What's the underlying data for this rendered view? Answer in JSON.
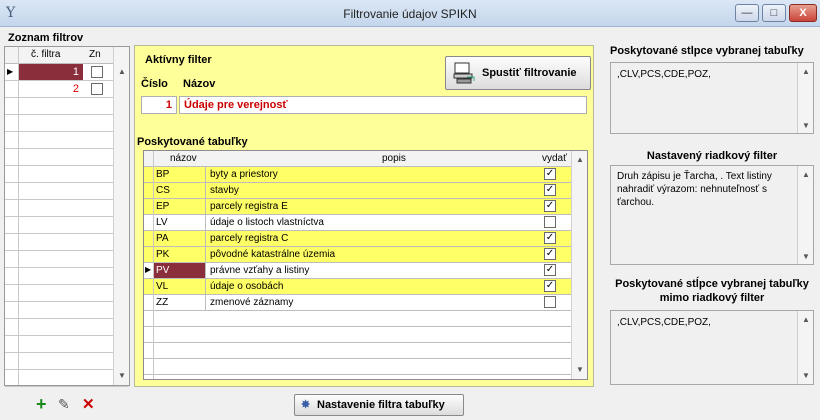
{
  "window": {
    "title": "Filtrovanie údajov SPIKN",
    "icon": "Y",
    "min": "—",
    "max": "□",
    "close": "X"
  },
  "filters": {
    "title": "Zoznam filtrov",
    "col_num": "č. filtra",
    "col_zn": "Zn",
    "rows": [
      {
        "num": "1",
        "checked": false,
        "selected": true
      },
      {
        "num": "2",
        "checked": false,
        "selected": false
      }
    ]
  },
  "active": {
    "title": "Aktívny filter",
    "num_label": "Číslo",
    "name_label": "Názov",
    "num_value": "1",
    "name_value": "Údaje pre verejnosť",
    "run_label": "Spustiť filtrovanie"
  },
  "tables": {
    "title": "Poskytované tabuľky",
    "col_name": "názov",
    "col_desc": "popis",
    "col_out": "vydať",
    "rows": [
      {
        "code": "BP",
        "desc": "byty a priestory",
        "on": true,
        "hl": true
      },
      {
        "code": "CS",
        "desc": "stavby",
        "on": true,
        "hl": true
      },
      {
        "code": "EP",
        "desc": "parcely registra E",
        "on": true,
        "hl": true
      },
      {
        "code": "LV",
        "desc": "údaje o listoch vlastníctva",
        "on": false,
        "hl": false
      },
      {
        "code": "PA",
        "desc": "parcely registra C",
        "on": true,
        "hl": true
      },
      {
        "code": "PK",
        "desc": "pôvodné katastrálne územia",
        "on": true,
        "hl": true
      },
      {
        "code": "PV",
        "desc": "právne vzťahy a listiny",
        "on": true,
        "hl": false,
        "sel": true
      },
      {
        "code": "VL",
        "desc": "údaje o osobách",
        "on": true,
        "hl": true
      },
      {
        "code": "ZZ",
        "desc": "zmenové záznamy",
        "on": false,
        "hl": false
      }
    ]
  },
  "right": {
    "cols_title": "Poskytované stĺpce vybranej tabuľky",
    "cols_value": ",CLV,PCS,CDE,POZ,",
    "row_filter_title": "Nastavený riadkový filter",
    "row_filter_value": "Druh zápisu je Ťarcha, . Text listiny nahradiť výrazom: nehnuteľnosť s ťarchou.",
    "outside_title": "Poskytované stĺpce vybranej tabuľky mimo riadkový filter",
    "outside_value": ",CLV,PCS,CDE,POZ,"
  },
  "footer": {
    "settings_label": "Nastavenie filtra tabuľky",
    "add": "+",
    "edit": "✎",
    "del": "✕"
  },
  "colors": {
    "selected": "#8b2e3c",
    "highlight": "#ffff66",
    "red": "#cc0000",
    "green": "#1a8a1a"
  }
}
